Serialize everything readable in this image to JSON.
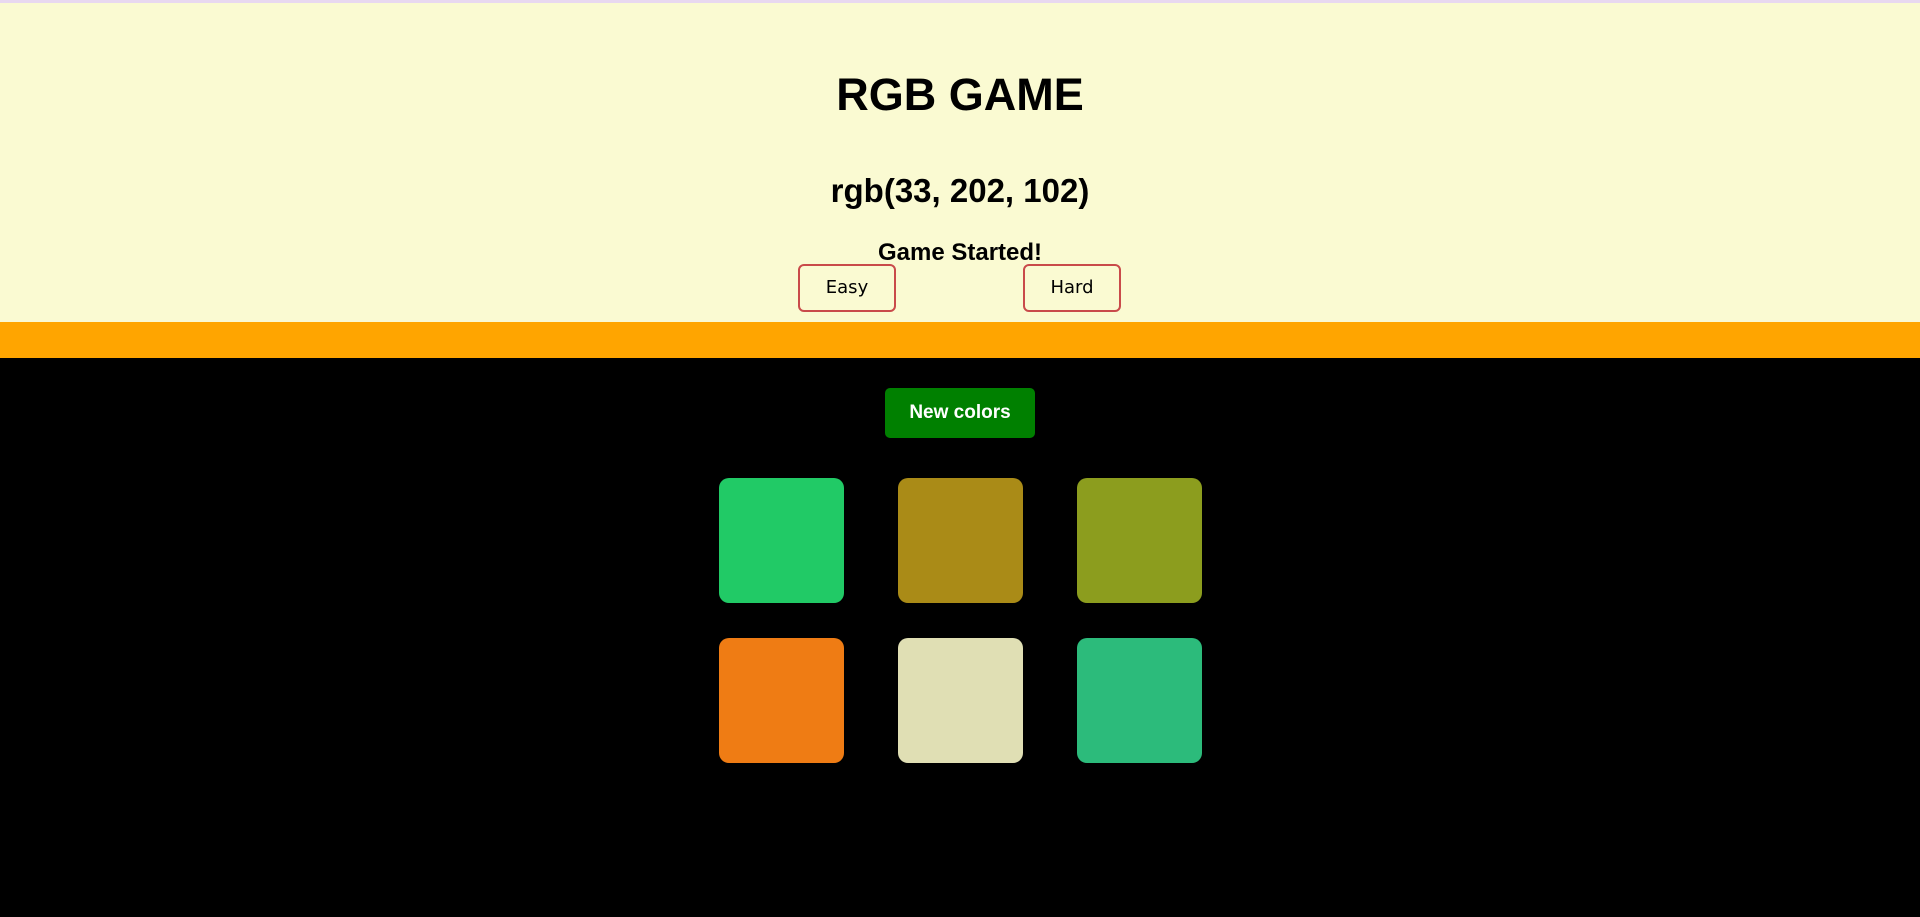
{
  "game": {
    "title": "RGB GAME",
    "target_color": "rgb(33, 202, 102)",
    "status": "Game Started!"
  },
  "modes": {
    "easy_label": "Easy",
    "hard_label": "Hard"
  },
  "controls": {
    "new_colors_label": "New colors"
  },
  "colors": {
    "header_bg": "#fafad2",
    "stripe": "#ffa500",
    "board_bg": "#000000",
    "button_green": "#008000",
    "mode_border": "#c94a4a"
  },
  "squares": [
    {
      "color": "#21ca66"
    },
    {
      "color": "#aa8b17"
    },
    {
      "color": "#8c9d1e"
    },
    {
      "color": "#ef7c14"
    },
    {
      "color": "#e0dfb4"
    },
    {
      "color": "#2cbb7b"
    }
  ]
}
